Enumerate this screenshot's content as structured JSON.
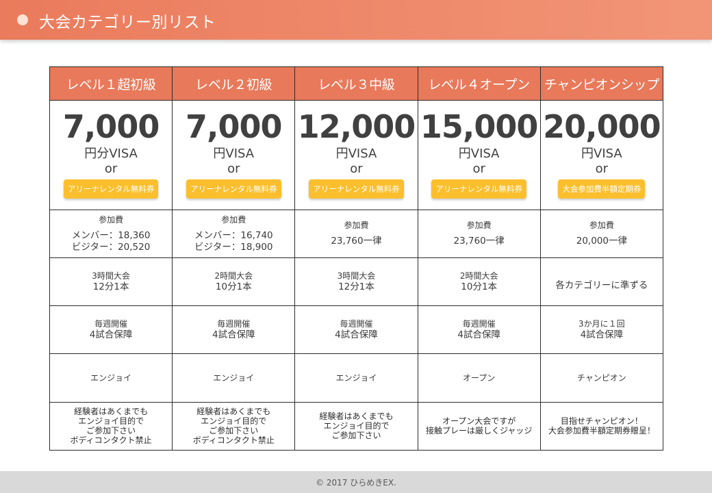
{
  "header": {
    "title": "大会カテゴリー別リスト"
  },
  "columns": [
    {
      "title": "レベル１超初級",
      "price": "7,000",
      "unit": "円分VISA",
      "or": "or",
      "badge": "アリーナレンタル無料券",
      "fee_title": "参加費",
      "fee_lines": [
        "メンバー：18,360",
        "ビジター：20,520"
      ],
      "time_lines": [
        "3時間大会",
        "12分1本"
      ],
      "schedule_lines": [
        "毎週開催",
        "4試合保障"
      ],
      "style": "エンジョイ",
      "note_lines": [
        "経験者はあくまでも",
        "エンジョイ目的で",
        "ご参加下さい",
        "ボディコンタクト禁止"
      ]
    },
    {
      "title": "レベル２初級",
      "price": "7,000",
      "unit": "円VISA",
      "or": "or",
      "badge": "アリーナレンタル無料券",
      "fee_title": "参加費",
      "fee_lines": [
        "メンバー：16,740",
        "ビジター：18,900"
      ],
      "time_lines": [
        "2時間大会",
        "10分1本"
      ],
      "schedule_lines": [
        "毎週開催",
        "4試合保障"
      ],
      "style": "エンジョイ",
      "note_lines": [
        "経験者はあくまでも",
        "エンジョイ目的で",
        "ご参加下さい",
        "ボディコンタクト禁止"
      ]
    },
    {
      "title": "レベル３中級",
      "price": "12,000",
      "unit": "円VISA",
      "or": "or",
      "badge": "アリーナレンタル無料券",
      "fee_title": "参加費",
      "fee_lines": [
        "23,760一律"
      ],
      "time_lines": [
        "3時間大会",
        "12分1本"
      ],
      "schedule_lines": [
        "毎週開催",
        "4試合保障"
      ],
      "style": "エンジョイ",
      "note_lines": [
        "経験者はあくまでも",
        "エンジョイ目的で",
        "ご参加下さい"
      ]
    },
    {
      "title": "レベル４オープン",
      "price": "15,000",
      "unit": "円VISA",
      "or": "or",
      "badge": "アリーナレンタル無料券",
      "fee_title": "参加費",
      "fee_lines": [
        "23,760一律"
      ],
      "time_lines": [
        "2時間大会",
        "10分1本"
      ],
      "schedule_lines": [
        "毎週開催",
        "4試合保障"
      ],
      "style": "オープン",
      "note_lines": [
        "オープン大会ですが",
        "接触プレーは厳しくジャッジ"
      ]
    },
    {
      "title": "チャンピオンシップ",
      "price": "20,000",
      "unit": "円VISA",
      "or": "or",
      "badge": "大会参加費半額定期券",
      "fee_title": "参加費",
      "fee_lines": [
        "20,000一律"
      ],
      "time_lines": [
        "各カテゴリーに準ずる"
      ],
      "schedule_lines": [
        "3か月に１回",
        "4試合保障"
      ],
      "style": "チャンピオン",
      "note_lines": [
        "目指せチャンピオン！",
        "大会参加費半額定期券贈呈！"
      ]
    }
  ],
  "footer": {
    "text": "© 2017 ひらめきEX."
  },
  "colors": {
    "header_gradient_start": "#ea7b5c",
    "header_gradient_end": "#f29577",
    "column_header": "#e8795a",
    "badge": "#fbbf2e",
    "footer": "#d9d9d9"
  }
}
